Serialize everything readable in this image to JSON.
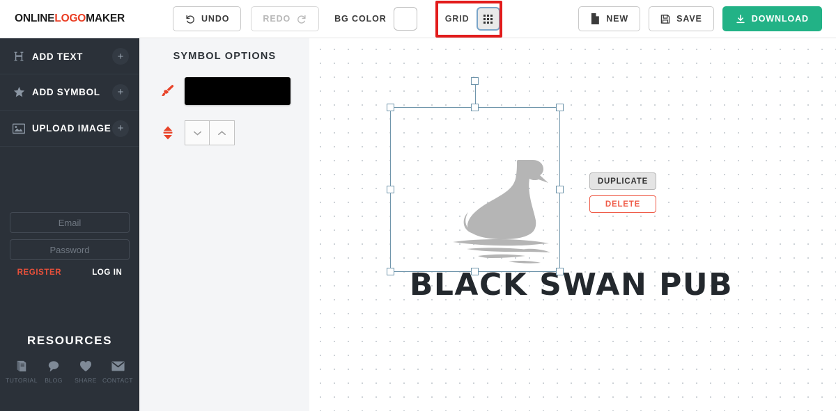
{
  "brand": {
    "part1": "ONLINE",
    "part2": "LOGO",
    "part3": "MAKER"
  },
  "toolbar": {
    "undo_label": "UNDO",
    "redo_label": "REDO",
    "bgcolor_label": "BG COLOR",
    "bgcolor_value": "#ffffff",
    "grid_label": "GRID",
    "new_label": "NEW",
    "save_label": "SAVE",
    "download_label": "DOWNLOAD",
    "download_color": "#22b286",
    "annotation_color": "#e21b1b"
  },
  "sidebar": {
    "items": [
      {
        "label": "ADD TEXT",
        "icon": "text-h-icon",
        "action": "plus-icon"
      },
      {
        "label": "ADD SYMBOL",
        "icon": "star-icon",
        "action": "plus-icon"
      },
      {
        "label": "UPLOAD IMAGE",
        "icon": "image-icon",
        "action": "plus-icon"
      }
    ],
    "auth": {
      "email_placeholder": "Email",
      "email_value": "",
      "password_placeholder": "Password",
      "password_value": "",
      "register_label": "REGISTER",
      "register_color": "#e8503a",
      "login_label": "LOG IN"
    },
    "resources": {
      "title": "RESOURCES",
      "items": [
        {
          "label": "TUTORIAL",
          "icon": "book-icon"
        },
        {
          "label": "BLOG",
          "icon": "speech-bubble-icon"
        },
        {
          "label": "SHARE",
          "icon": "heart-icon"
        },
        {
          "label": "CONTACT",
          "icon": "envelope-icon"
        }
      ]
    }
  },
  "options": {
    "title": "SYMBOL OPTIONS",
    "color_row": {
      "icon": "paintbrush-icon",
      "swatch_value": "#000000"
    },
    "size_row": {
      "icon": "up-down-arrow-icon",
      "decrease_label": "⌄",
      "increase_label": "⌃"
    }
  },
  "canvas": {
    "logo_text": "BLACK SWAN PUB",
    "logo_text_color": "#23282d",
    "symbol_name": "swan-symbol",
    "symbol_color": "#b5b5b5",
    "selection_color": "#6f95ab",
    "context_menu": {
      "duplicate_label": "DUPLICATE",
      "delete_label": "DELETE",
      "delete_color": "#ef5a47"
    }
  }
}
